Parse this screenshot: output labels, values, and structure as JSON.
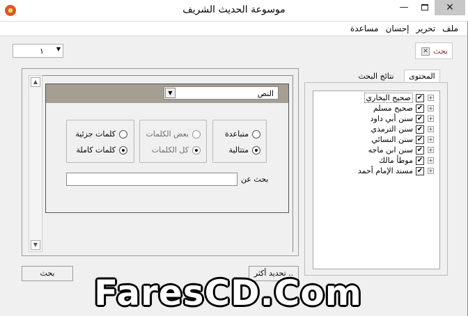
{
  "window": {
    "title": "موسوعة الحديث الشريف",
    "minimize": "—",
    "close": "✕"
  },
  "menu": [
    "ملف",
    "تحرير",
    "إحسان",
    "مساعدة"
  ],
  "search_tab": {
    "label": "بحث",
    "close": "✕"
  },
  "page_select": {
    "value": "١"
  },
  "tabs": {
    "content": "المحتوى",
    "results": "نتائج البحث"
  },
  "books": [
    {
      "label": "صحيح البخاري",
      "checked": true,
      "selected": true
    },
    {
      "label": "صحيح مسلم",
      "checked": true
    },
    {
      "label": "سنن أبي داود",
      "checked": true
    },
    {
      "label": "سنن الترمذي",
      "checked": true
    },
    {
      "label": "سنن النسائي",
      "checked": true
    },
    {
      "label": "سنن ابن ماجه",
      "checked": true
    },
    {
      "label": "موطأ مالك",
      "checked": true
    },
    {
      "label": "مسند الإمام أحمد",
      "checked": true
    }
  ],
  "field_select": {
    "value": "النص"
  },
  "options": {
    "distance": {
      "far": "متباعدة",
      "near": "متتالية",
      "selected": "near"
    },
    "coverage": {
      "some": "بعض الكلمات",
      "all": "كل الكلمات",
      "selected": "all"
    },
    "match": {
      "partial": "كلمات جزئية",
      "whole": "كلمات كاملة",
      "selected": "whole"
    }
  },
  "search_for": {
    "label": "بحث عن",
    "value": ""
  },
  "buttons": {
    "search": "بحث",
    "more": "تحديد أكثر .."
  },
  "watermark": "FaresCD.Com"
}
